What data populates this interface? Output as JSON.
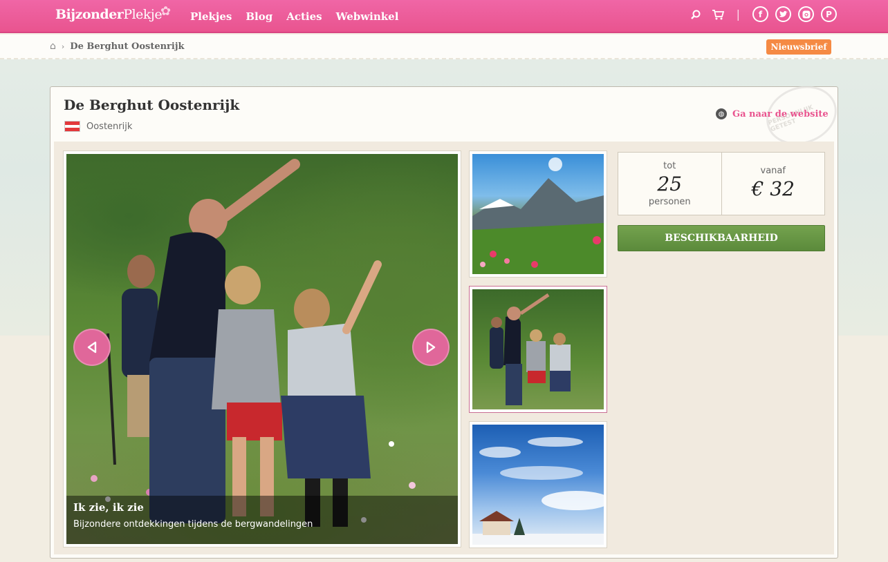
{
  "brand": {
    "name_bold": "Bijzonder",
    "name_light": "Plekje"
  },
  "nav": [
    "Plekjes",
    "Blog",
    "Acties",
    "Webwinkel"
  ],
  "top_icons": {
    "search": "search-icon",
    "cart": "cart-icon",
    "social": [
      "facebook-icon",
      "twitter-icon",
      "instagram-icon",
      "pinterest-icon"
    ]
  },
  "breadcrumb": {
    "current": "De Berghut Oostenrijk"
  },
  "newsletter_label": "Nieuwsbrief",
  "listing": {
    "title": "De Berghut Oostenrijk",
    "country": "Oostenrijk",
    "website_label": "Ga naar de website",
    "stamp_text": "PERSOONLIJK GETEST"
  },
  "slide": {
    "title": "Ik zie, ik zie",
    "subtitle": "Bijzondere ontdekkingen tijdens de bergwandelingen"
  },
  "capacity": {
    "prefix": "tot",
    "value": "25",
    "unit": "personen"
  },
  "price": {
    "prefix": "vanaf",
    "value": "€ 32"
  },
  "availability_label": "BESCHIKBAARHEID",
  "colors": {
    "brand_pink": "#e9548f",
    "accent_orange": "#f58a44",
    "button_green": "#5b8a3b"
  }
}
